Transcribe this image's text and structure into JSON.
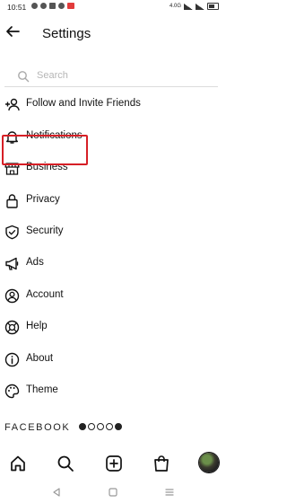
{
  "status_bar": {
    "time": "10:51",
    "network": "4.0G"
  },
  "header": {
    "title": "Settings",
    "back_icon": "arrow-left-icon"
  },
  "search": {
    "placeholder": "Search",
    "icon": "search-icon"
  },
  "menu": {
    "items": [
      {
        "label": "Follow and Invite Friends",
        "icon": "add-person-icon"
      },
      {
        "label": "Notifications",
        "icon": "bell-icon"
      },
      {
        "label": "Business",
        "icon": "shop-icon"
      },
      {
        "label": "Privacy",
        "icon": "lock-icon"
      },
      {
        "label": "Security",
        "icon": "shield-icon"
      },
      {
        "label": "Ads",
        "icon": "megaphone-icon"
      },
      {
        "label": "Account",
        "icon": "user-circle-icon"
      },
      {
        "label": "Help",
        "icon": "lifebuoy-icon"
      },
      {
        "label": "About",
        "icon": "info-icon"
      },
      {
        "label": "Theme",
        "icon": "palette-icon"
      }
    ],
    "highlighted_item": "Business",
    "highlight_color": "#d61f26"
  },
  "footer": {
    "brand": "FACEBOOK"
  },
  "bottom_nav": {
    "items": [
      "home-icon",
      "search-icon",
      "new-post-icon",
      "shop-bag-icon",
      "profile-avatar"
    ]
  },
  "system_nav": {
    "items": [
      "back-triangle-icon",
      "home-square-icon",
      "recents-menu-icon"
    ]
  }
}
